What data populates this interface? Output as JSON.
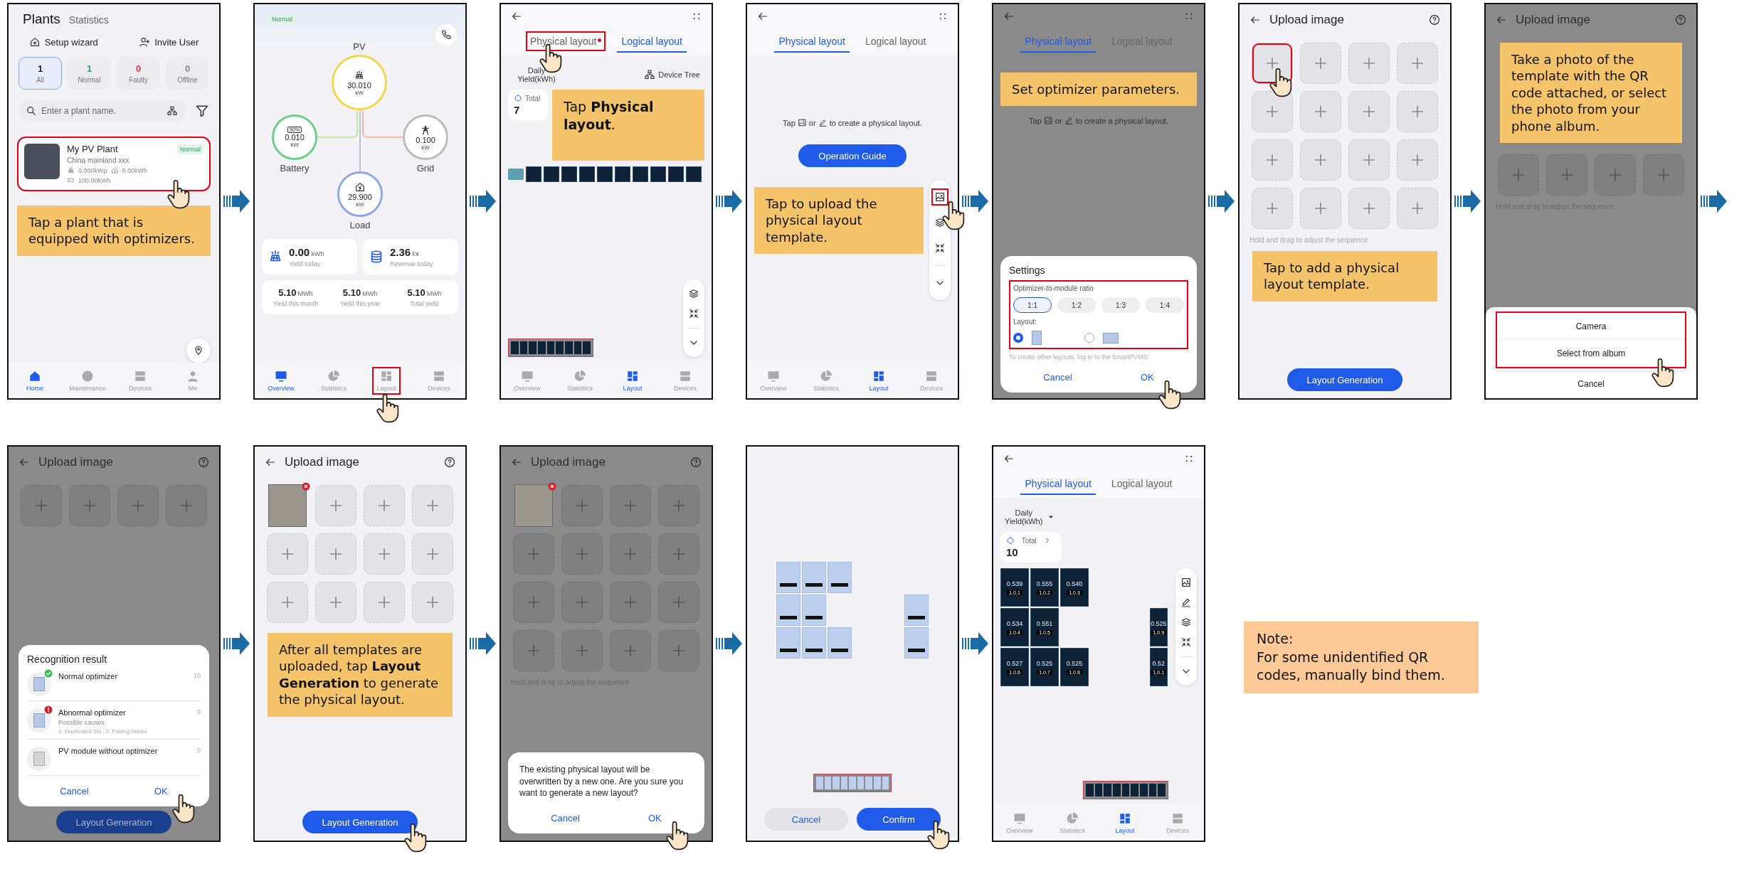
{
  "rows": [
    {
      "steps": [
        {
          "kind": "plants",
          "dimmed": false,
          "arrow": true,
          "header_tabs": [
            {
              "label": "Plants",
              "selected": true
            },
            {
              "label": "Statistics",
              "selected": false
            }
          ],
          "actions": [
            "Setup wizard",
            "Invite User"
          ],
          "filters": [
            {
              "count": "1",
              "label": "All",
              "selected": true,
              "color": "#222222"
            },
            {
              "count": "1",
              "label": "Normal",
              "selected": false,
              "color": "#2e9e5b"
            },
            {
              "count": "0",
              "label": "Faulty",
              "selected": false,
              "color": "#e8344e"
            },
            {
              "count": "0",
              "label": "Offline",
              "selected": false,
              "color": "#888888"
            }
          ],
          "search": {
            "placeholder": "Enter a plant name."
          },
          "plant": {
            "name": "My PV Plant",
            "status": "Normal",
            "location": "China mainland xxx",
            "capacity": "0.000kWp",
            "yield": "0.00kWh",
            "total": "100.00kWh",
            "highlighted": true,
            "tapped": true
          },
          "callout": "Tap a plant that is equipped with optimizers.",
          "nav": [
            {
              "label": "Home",
              "selected": true
            },
            {
              "label": "Maintenance",
              "selected": false
            },
            {
              "label": "Devices",
              "selected": false
            },
            {
              "label": "Me",
              "selected": false
            }
          ]
        },
        {
          "kind": "overview",
          "dimmed": false,
          "arrow": true,
          "status": "Normal",
          "nodes": [
            {
              "label": "PV",
              "value": "30.010",
              "unit": "kW",
              "color": "#f2d64b"
            },
            {
              "label": "Battery",
              "value": "0.010",
              "unit": "kW",
              "color": "#6ccf8a",
              "badge": "50%"
            },
            {
              "label": "Grid",
              "value": "0.100",
              "unit": "kW",
              "color": "#bdbdbd"
            },
            {
              "label": "Load",
              "value": "29.900",
              "unit": "kW",
              "color": "#8fa8e8"
            }
          ],
          "today": [
            {
              "value": "0.00",
              "unit": "kWh",
              "label": "Yield today"
            },
            {
              "value": "2.36",
              "unit": "k¥",
              "label": "Revenue today"
            }
          ],
          "totals": [
            {
              "value": "5.10",
              "unit": "MWh",
              "label": "Yield this month"
            },
            {
              "value": "5.10",
              "unit": "MWh",
              "label": "Yield this year"
            },
            {
              "value": "5.10",
              "unit": "MWh",
              "label": "Total yield"
            }
          ],
          "nav": [
            {
              "label": "Overview",
              "selected": true,
              "highlighted": false,
              "tapped": false
            },
            {
              "label": "Statistics",
              "selected": false,
              "highlighted": false,
              "tapped": false
            },
            {
              "label": "Layout",
              "selected": false,
              "highlighted": true,
              "tapped": true
            },
            {
              "label": "Devices",
              "selected": false,
              "highlighted": false,
              "tapped": false
            }
          ]
        },
        {
          "kind": "layout-tabs",
          "dimmed": false,
          "arrow": true,
          "tabs": [
            {
              "label": "Physical layout",
              "selected": false,
              "dot": true,
              "highlighted": true,
              "tapped": true
            },
            {
              "label": "Logical layout",
              "selected": true,
              "dot": false,
              "highlighted": false,
              "tapped": false
            }
          ],
          "metric": "Daily Yield(kWh)",
          "device_tree": "Device Tree",
          "total": {
            "label": "Total",
            "value": "7"
          },
          "callout": "Tap **Physical layout**.",
          "nav": [
            {
              "label": "Overview",
              "selected": false
            },
            {
              "label": "Statistics",
              "selected": false
            },
            {
              "label": "Layout",
              "selected": true
            },
            {
              "label": "Devices",
              "selected": false
            }
          ]
        },
        {
          "kind": "layout-guide",
          "dimmed": false,
          "arrow": true,
          "tabs": [
            {
              "label": "Physical layout",
              "selected": true
            },
            {
              "label": "Logical layout",
              "selected": false
            }
          ],
          "hint": {
            "before": "Tap",
            "middle": "or",
            "after": "to create a physical layout."
          },
          "guide_button": "Operation Guide",
          "callout": "Tap to upload the physical layout template.",
          "tools": [
            {
              "highlighted": true,
              "tapped": true
            },
            {
              "highlighted": false,
              "tapped": false
            },
            {
              "highlighted": false,
              "tapped": false
            },
            {
              "highlighted": false,
              "tapped": false
            }
          ],
          "nav": [
            {
              "label": "Overview",
              "selected": false
            },
            {
              "label": "Statistics",
              "selected": false
            },
            {
              "label": "Layout",
              "selected": true
            },
            {
              "label": "Devices",
              "selected": false
            }
          ]
        },
        {
          "kind": "settings",
          "dimmed": true,
          "arrow": true,
          "tabs": [
            {
              "label": "Physical layout",
              "selected": true
            },
            {
              "label": "Logical layout",
              "selected": false
            }
          ],
          "callout": "Set optimizer parameters.",
          "hint": {
            "before": "Tap",
            "middle": "or",
            "after": "to create a physical layout."
          },
          "dialog": {
            "title": "Settings",
            "highlighted": true,
            "ratio_label": "Optimizer-to-module ratio",
            "ratios": [
              {
                "label": "1:1",
                "selected": true
              },
              {
                "label": "1:2",
                "selected": false
              },
              {
                "label": "1:3",
                "selected": false
              },
              {
                "label": "1:4",
                "selected": false
              }
            ],
            "layout_label": "Layout:",
            "orientations": [
              {
                "selected": true
              },
              {
                "selected": false
              }
            ],
            "footnote": "To create other layouts, log in to the SmartPVMS.",
            "buttons": [
              {
                "label": "Cancel",
                "tapped": false
              },
              {
                "label": "OK",
                "tapped": true
              }
            ]
          }
        },
        {
          "kind": "upload",
          "dimmed": false,
          "arrow": true,
          "title": "Upload image",
          "slots": [
            {
              "filled": false,
              "highlighted": true,
              "tapped": true
            },
            {
              "filled": false,
              "highlighted": false,
              "tapped": false
            },
            {
              "filled": false,
              "highlighted": false,
              "tapped": false
            },
            {
              "filled": false,
              "highlighted": false,
              "tapped": false
            },
            {
              "filled": false,
              "highlighted": false,
              "tapped": false
            },
            {
              "filled": false,
              "highlighted": false,
              "tapped": false
            },
            {
              "filled": false,
              "highlighted": false,
              "tapped": false
            },
            {
              "filled": false,
              "highlighted": false,
              "tapped": false
            },
            {
              "filled": false,
              "highlighted": false,
              "tapped": false
            },
            {
              "filled": false,
              "highlighted": false,
              "tapped": false
            },
            {
              "filled": false,
              "highlighted": false,
              "tapped": false
            },
            {
              "filled": false,
              "highlighted": false,
              "tapped": false
            },
            {
              "filled": false,
              "highlighted": false,
              "tapped": false
            },
            {
              "filled": false,
              "highlighted": false,
              "tapped": false
            },
            {
              "filled": false,
              "highlighted": false,
              "tapped": false
            },
            {
              "filled": false,
              "highlighted": false,
              "tapped": false
            }
          ],
          "hint_text": "Hold and drag to adjust the sequence",
          "callout": "Tap to add a physical layout template.",
          "button": {
            "label": "Layout Generation",
            "tapped": false
          }
        },
        {
          "kind": "photo-source",
          "dimmed": true,
          "arrow": true,
          "title": "Upload image",
          "callout": "Take a photo of the template with the QR code attached, or select the photo from your phone album.",
          "slots": [
            {
              "filled": false
            },
            {
              "filled": false
            },
            {
              "filled": false
            },
            {
              "filled": false
            }
          ],
          "hint_text": "Hold and drag to adjust the sequence",
          "sheet": {
            "highlighted": true,
            "options": [
              {
                "label": "Camera",
                "tapped": false
              },
              {
                "label": "Select from album",
                "tapped": true
              }
            ],
            "cancel": "Cancel"
          }
        }
      ]
    },
    {
      "steps": [
        {
          "kind": "recognition",
          "dimmed": true,
          "arrow": true,
          "title": "Upload image",
          "slots": [
            {
              "filled": false
            },
            {
              "filled": false
            },
            {
              "filled": false
            },
            {
              "filled": false
            }
          ],
          "result": {
            "title": "Recognition result",
            "items": [
              {
                "kind": "ok",
                "label": "Normal optimizer",
                "count": "10"
              },
              {
                "kind": "error",
                "label": "Abnormal optimizer",
                "count": "0",
                "detail": "Possible causes",
                "causes": "1. Duplicated SN ; 2. Pairing failure"
              },
              {
                "kind": "none",
                "label": "PV module without optimizer",
                "count": "0"
              }
            ],
            "buttons": [
              {
                "label": "Cancel",
                "tapped": false
              },
              {
                "label": "OK",
                "tapped": true
              }
            ]
          },
          "button": {
            "label": "Layout Generation",
            "tapped": false
          }
        },
        {
          "kind": "upload-done",
          "dimmed": false,
          "arrow": true,
          "title": "Upload image",
          "slots": [
            {
              "filled": true
            },
            {
              "filled": false
            },
            {
              "filled": false
            },
            {
              "filled": false
            },
            {
              "filled": false
            },
            {
              "filled": false
            },
            {
              "filled": false
            },
            {
              "filled": false
            },
            {
              "filled": false
            },
            {
              "filled": false
            },
            {
              "filled": false
            },
            {
              "filled": false
            }
          ],
          "callout": "After all templates are uploaded, tap **Layout Generation** to generate the physical layout.",
          "button": {
            "label": "Layout Generation",
            "tapped": true
          }
        },
        {
          "kind": "confirm",
          "dimmed": true,
          "arrow": true,
          "title": "Upload image",
          "slots": [
            {
              "filled": true
            },
            {
              "filled": false
            },
            {
              "filled": false
            },
            {
              "filled": false
            },
            {
              "filled": false
            },
            {
              "filled": false
            },
            {
              "filled": false
            },
            {
              "filled": false
            },
            {
              "filled": false
            },
            {
              "filled": false
            },
            {
              "filled": false
            },
            {
              "filled": false
            },
            {
              "filled": false
            },
            {
              "filled": false
            },
            {
              "filled": false
            },
            {
              "filled": false
            }
          ],
          "hint_text": "Hold and drag to adjust the sequence",
          "confirm": {
            "message": "The existing physical layout will be overwritten by a new one. Are you sure you want to generate a new layout?",
            "buttons": [
              {
                "label": "Cancel",
                "tapped": false
              },
              {
                "label": "OK",
                "tapped": true
              }
            ]
          }
        },
        {
          "kind": "preview",
          "dimmed": false,
          "arrow": true,
          "buttons": [
            {
              "label": "Cancel",
              "tapped": false
            },
            {
              "label": "Confirm",
              "tapped": true
            }
          ]
        },
        {
          "kind": "result",
          "dimmed": false,
          "arrow": false,
          "tabs": [
            {
              "label": "Physical layout",
              "selected": true
            },
            {
              "label": "Logical layout",
              "selected": false
            }
          ],
          "metric": "Daily Yield(kWh)",
          "total": {
            "label": "Total",
            "value": "10"
          },
          "modules": [
            {
              "value": "0.539",
              "id": "1.0.1"
            },
            {
              "value": "0.555",
              "id": "1.0.2"
            },
            {
              "value": "0.540",
              "id": "1.0.3"
            },
            {
              "value": "0.534",
              "id": "1.0.4"
            },
            {
              "value": "0.551",
              "id": "1.0.5"
            },
            {
              "value": "0.525",
              "id": "1.0.9"
            },
            {
              "value": "0.527",
              "id": "1.0.6"
            },
            {
              "value": "0.525",
              "id": "1.0.7"
            },
            {
              "value": "0.525",
              "id": "1.0.8"
            },
            {
              "value": "0.52",
              "id": "1.0.1"
            }
          ],
          "nav": [
            {
              "label": "Overview",
              "selected": false
            },
            {
              "label": "Statistics",
              "selected": false
            },
            {
              "label": "Layout",
              "selected": true
            },
            {
              "label": "Devices",
              "selected": false
            }
          ]
        }
      ],
      "note": {
        "title": "Note:",
        "text": "For some unidentified QR codes, manually bind them."
      }
    }
  ]
}
